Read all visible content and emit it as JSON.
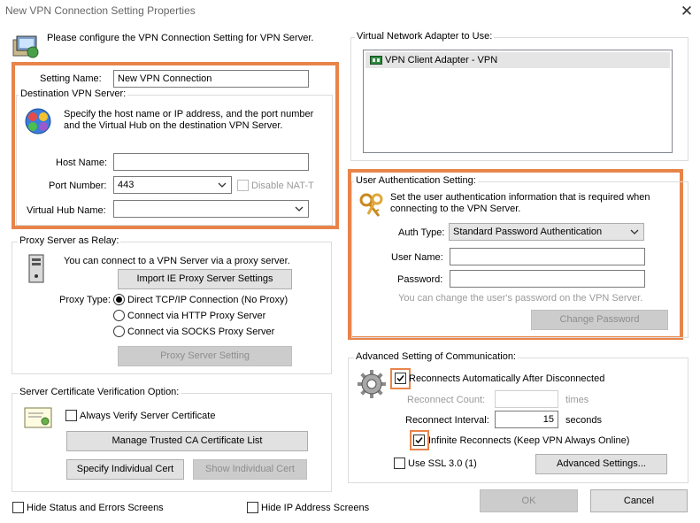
{
  "window": {
    "title": "New VPN Connection Setting Properties"
  },
  "header": {
    "instruction": "Please configure the VPN Connection Setting for VPN Server."
  },
  "setting_name": {
    "label": "Setting Name:",
    "value": "New VPN Connection"
  },
  "destination": {
    "group_title": "Destination VPN Server:",
    "description_line1": "Specify the host name or IP address, and the port number",
    "description_line2": "and the Virtual Hub on the destination VPN Server.",
    "host_label": "Host Name:",
    "host_value": "",
    "port_label": "Port Number:",
    "port_value": "443",
    "disable_nat_label": "Disable NAT-T",
    "hub_label": "Virtual Hub Name:",
    "hub_value": ""
  },
  "proxy": {
    "group_title": "Proxy Server as Relay:",
    "description": "You can connect to a VPN Server via a proxy server.",
    "import_button": "Import IE Proxy Server Settings",
    "type_label": "Proxy Type:",
    "options": [
      {
        "label": "Direct TCP/IP Connection (No Proxy)",
        "selected": true
      },
      {
        "label": "Connect via HTTP Proxy Server",
        "selected": false
      },
      {
        "label": "Connect via SOCKS Proxy Server",
        "selected": false
      }
    ],
    "setting_button": "Proxy Server Setting"
  },
  "certificate": {
    "group_title": "Server Certificate Verification Option:",
    "always_verify_label": "Always Verify Server Certificate",
    "manage_button": "Manage Trusted CA Certificate List",
    "specify_button": "Specify Individual Cert",
    "show_button": "Show Individual Cert"
  },
  "bottom_options": {
    "hide_status_label": "Hide Status and Errors Screens",
    "hide_ip_label": "Hide IP Address Screens"
  },
  "adapter": {
    "group_title": "Virtual Network Adapter to Use:",
    "items": [
      "VPN Client Adapter - VPN"
    ]
  },
  "auth": {
    "group_title": "User Authentication Setting:",
    "description_line1": "Set the user authentication information that is required when",
    "description_line2": "connecting to the VPN Server.",
    "type_label": "Auth Type:",
    "type_value": "Standard Password Authentication",
    "username_label": "User Name:",
    "username_value": "",
    "password_label": "Password:",
    "password_value": "",
    "hint": "You can change the user's password on the VPN Server.",
    "change_password_button": "Change Password"
  },
  "advanced": {
    "group_title": "Advanced Setting of Communication:",
    "reconnect_auto_label": "Reconnects Automatically After Disconnected",
    "reconnect_count_label": "Reconnect Count:",
    "reconnect_count_value": "",
    "reconnect_count_unit": "times",
    "reconnect_interval_label": "Reconnect Interval:",
    "reconnect_interval_value": "15",
    "reconnect_interval_unit": "seconds",
    "infinite_label": "Infinite Reconnects (Keep VPN Always Online)",
    "ssl_label": "Use SSL 3.0 (1)",
    "advanced_button": "Advanced Settings..."
  },
  "footer": {
    "ok_label": "OK",
    "cancel_label": "Cancel"
  },
  "colors": {
    "highlight": "#e8844a",
    "accent_blue": "#0078d7"
  }
}
